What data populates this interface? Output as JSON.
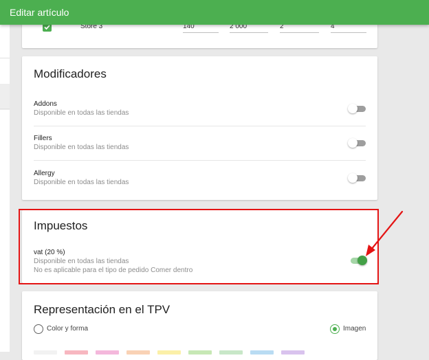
{
  "header": {
    "title": "Editar artículo"
  },
  "stores": {
    "row": {
      "checked": true,
      "name": "Store 3",
      "values": [
        "140",
        "2 000",
        "2",
        "4"
      ]
    }
  },
  "modifiers": {
    "title": "Modificadores",
    "items": [
      {
        "name": "Addons",
        "availability": "Disponible en todas las tiendas",
        "enabled": false
      },
      {
        "name": "Fillers",
        "availability": "Disponible en todas las tiendas",
        "enabled": false
      },
      {
        "name": "Allergy",
        "availability": "Disponible en todas las tiendas",
        "enabled": false
      }
    ]
  },
  "taxes": {
    "title": "Impuestos",
    "item": {
      "name": "vat (20 %)",
      "availability": "Disponible en todas las tiendas",
      "note": "No es aplicable para el tipo de pedido Comer dentro",
      "enabled": true
    }
  },
  "pos": {
    "title": "Representación en el TPV",
    "options": [
      {
        "label": "Color y forma",
        "selected": false
      },
      {
        "label": "Imagen",
        "selected": true
      }
    ],
    "swatches": [
      "#f2f2f2",
      "#f7b7c0",
      "#f4b8dc",
      "#f9d2b5",
      "#fbf0a8",
      "#c7e8b5",
      "#c8e7c8",
      "#b9dcf3",
      "#d9c3ee"
    ]
  },
  "colors": {
    "accent": "#4caf50",
    "annotation": "#e41414"
  }
}
